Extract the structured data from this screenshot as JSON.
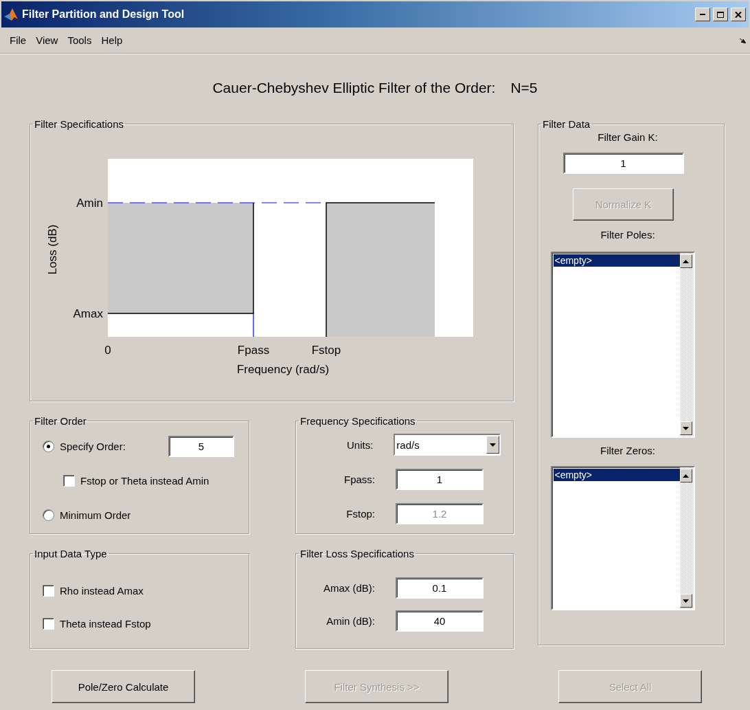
{
  "window": {
    "title": "Filter Partition and Design Tool"
  },
  "menu": [
    {
      "label": "File"
    },
    {
      "label": "View"
    },
    {
      "label": "Tools"
    },
    {
      "label": "Help"
    }
  ],
  "heading": {
    "text": "Cauer-Chebyshev Elliptic Filter of the Order:",
    "order": "N=5"
  },
  "filter_specifications": {
    "title": "Filter Specifications",
    "plot": {
      "ylabel": "Loss (dB)",
      "xlabel": "Frequency (rad/s)",
      "y_labels": [
        "Amin",
        "Amax"
      ],
      "x_labels": [
        "0",
        "Fpass",
        "Fstop"
      ]
    }
  },
  "filter_order": {
    "title": "Filter Order",
    "options": [
      {
        "kind": "radio",
        "label": "Specify Order:",
        "selected": true,
        "value": "5"
      },
      {
        "kind": "checkbox",
        "label": "Fstop or Theta instead Amin",
        "checked": false
      },
      {
        "kind": "radio",
        "label": "Minimum Order",
        "selected": false
      }
    ]
  },
  "frequency_specifications": {
    "title": "Frequency Specifications",
    "fields": [
      {
        "kind": "dropdown",
        "label": "Units:",
        "value": "rad/s",
        "disabled": false
      },
      {
        "kind": "input",
        "label": "Fpass:",
        "value": "1",
        "disabled": false
      },
      {
        "kind": "input",
        "label": "Fstop:",
        "value": "1.2",
        "disabled": true
      }
    ]
  },
  "input_data_type": {
    "title": "Input Data Type",
    "options": [
      {
        "label": "Rho instead Amax",
        "checked": false
      },
      {
        "label": "Theta instead Fstop",
        "checked": false
      }
    ]
  },
  "filter_loss_specifications": {
    "title": "Filter Loss Specifications",
    "fields": [
      {
        "kind": "input",
        "label": "Amax (dB):",
        "value": "0.1",
        "disabled": false
      },
      {
        "kind": "input",
        "label": "Amin (dB):",
        "value": "40",
        "disabled": false
      }
    ]
  },
  "filter_data": {
    "title": "Filter Data",
    "gain_label": "Filter Gain K:",
    "gain_value": "1",
    "normalize_button": {
      "label": "Normalize K",
      "disabled": true
    },
    "lists": [
      {
        "label": "Filter Poles:",
        "items": [
          {
            "text": "<empty>",
            "selected": true
          }
        ]
      },
      {
        "label": "Filter Zeros:",
        "items": [
          {
            "text": "<empty>",
            "selected": true
          }
        ]
      }
    ]
  },
  "buttons": [
    {
      "label": "Pole/Zero Calculate",
      "disabled": false
    },
    {
      "label": "Filter Synthesis >>",
      "disabled": true
    },
    {
      "label": "Select All",
      "disabled": true
    }
  ]
}
